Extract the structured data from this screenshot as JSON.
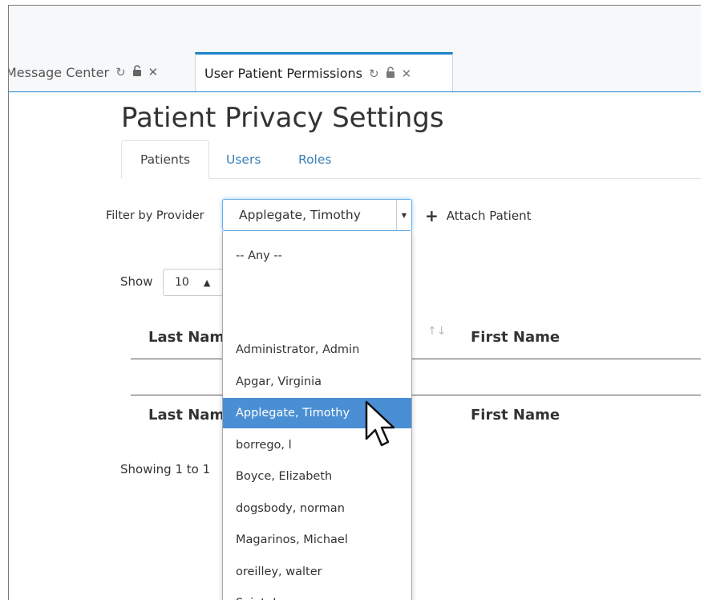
{
  "window_tabs": [
    {
      "label": "Message Center",
      "active": false
    },
    {
      "label": "User Patient Permissions",
      "active": true
    }
  ],
  "page": {
    "title": "Patient Privacy Settings"
  },
  "subtabs": [
    "Patients",
    "Users",
    "Roles"
  ],
  "filter": {
    "label": "Filter by Provider",
    "selected": "Applegate, Timothy",
    "attach_label": "Attach Patient"
  },
  "dropdown": {
    "options": [
      "-- Any --",
      "",
      "Administrator, Admin",
      "Apgar, Virginia",
      "Applegate, Timothy",
      "borrego, l",
      "Boyce, Elizabeth",
      "dogsbody, norman",
      "Magarinos, Michael",
      "oreilley, walter",
      "Saint, Lenny"
    ],
    "highlighted_index": 4
  },
  "table": {
    "show_label": "Show",
    "page_size": "10",
    "columns": [
      "Last Name",
      "First Name"
    ],
    "footer_columns": [
      "Last Name",
      "First Name"
    ],
    "showing_text": "Showing 1 to 1"
  },
  "icons": {
    "refresh": "refresh-icon",
    "lock": "lock-icon",
    "close": "close-icon"
  },
  "colors": {
    "accent": "#1e82c8",
    "highlight": "#4a8fd4",
    "link": "#3a7fb7"
  }
}
